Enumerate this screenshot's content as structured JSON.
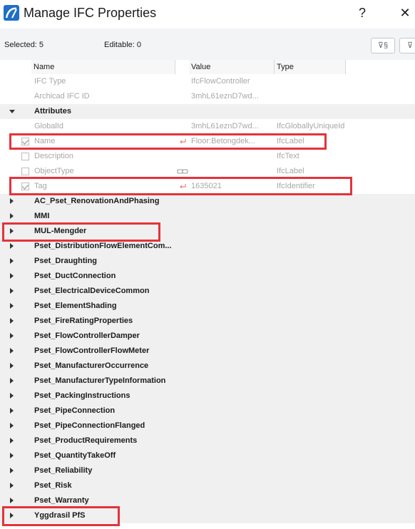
{
  "window": {
    "title": "Manage IFC Properties",
    "help_label": "?",
    "close_label": "✕"
  },
  "toolbar": {
    "selected": "Selected: 5",
    "editable": "Editable: 0",
    "filter_btn_1": "⊽§",
    "filter_btn_2": "⊽"
  },
  "columns": {
    "name": "Name",
    "value": "Value",
    "type": "Type"
  },
  "top_rows": [
    {
      "name": "IFC Type",
      "value": "IfcFlowController",
      "type": ""
    },
    {
      "name": "Archicad IFC ID",
      "value": "3mhL61eznD7wd...",
      "type": ""
    }
  ],
  "attributes": {
    "label": "Attributes",
    "rows": [
      {
        "name": "GlobalId",
        "value": "3mhL61eznD7wd...",
        "type": "IfcGloballyUniqueId",
        "checkbox": false,
        "icon": ""
      },
      {
        "name": "Name",
        "value": "Floor:Betongdek...",
        "type": "IfcLabel",
        "checkbox": true,
        "icon": "reset-link-icon"
      },
      {
        "name": "Description",
        "value": "",
        "type": "IfcText",
        "checkbox": true,
        "icon": ""
      },
      {
        "name": "ObjectType",
        "value": "",
        "type": "IfcLabel",
        "checkbox": true,
        "icon": "chain-link-icon"
      },
      {
        "name": "Tag",
        "value": "1635021",
        "type": "IfcIdentifier",
        "checkbox": true,
        "icon": "reset-link-icon"
      }
    ]
  },
  "groups": [
    "AC_Pset_RenovationAndPhasing",
    "MMI",
    "MUL-Mengder",
    "Pset_DistributionFlowElementCom...",
    "Pset_Draughting",
    "Pset_DuctConnection",
    "Pset_ElectricalDeviceCommon",
    "Pset_ElementShading",
    "Pset_FireRatingProperties",
    "Pset_FlowControllerDamper",
    "Pset_FlowControllerFlowMeter",
    "Pset_ManufacturerOccurrence",
    "Pset_ManufacturerTypeInformation",
    "Pset_PackingInstructions",
    "Pset_PipeConnection",
    "Pset_PipeConnectionFlanged",
    "Pset_ProductRequirements",
    "Pset_QuantityTakeOff",
    "Pset_Reliability",
    "Pset_Risk",
    "Pset_Warranty",
    "Yggdrasil PfS"
  ],
  "colors": {
    "highlight": "#e5323a",
    "reset_icon": "#e8857a",
    "accent": "#1f6fc5"
  }
}
